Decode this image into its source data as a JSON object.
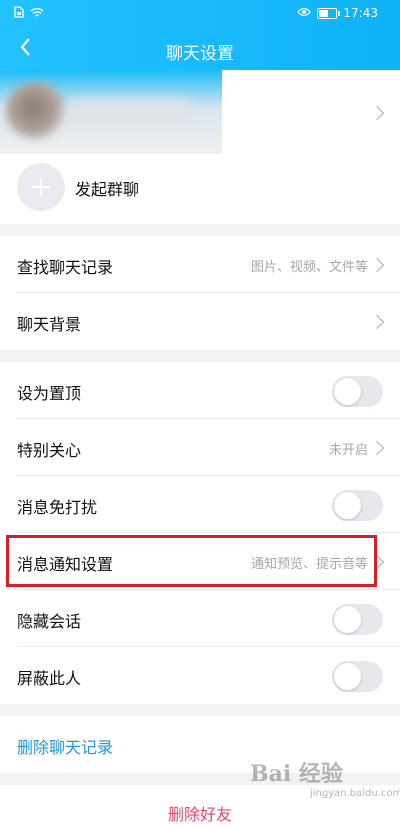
{
  "status_bar": {
    "time": "17:43"
  },
  "header": {
    "title": "聊天设置"
  },
  "group": {
    "start_group_chat": "发起群聊"
  },
  "search_section": [
    {
      "label": "查找聊天记录",
      "hint": "图片、视频、文件等"
    },
    {
      "label": "聊天背景",
      "hint": ""
    }
  ],
  "settings": {
    "pin_top": {
      "label": "设为置顶",
      "on": false
    },
    "special_care": {
      "label": "特别关心",
      "hint": "未开启"
    },
    "dnd": {
      "label": "消息免打扰",
      "on": false
    },
    "notification": {
      "label": "消息通知设置",
      "hint": "通知预览、提示音等"
    },
    "hide_chat": {
      "label": "隐藏会话",
      "on": false
    },
    "block": {
      "label": "屏蔽此人",
      "on": false
    }
  },
  "actions": {
    "delete_history": "删除聊天记录",
    "delete_friend": "删除好友"
  },
  "watermark": {
    "main": "Bai 经验",
    "sub": "jingyan.baidu.com"
  },
  "colors": {
    "header": "#1cbaf9",
    "highlight_box": "#d71f2a",
    "link": "#2196d8",
    "danger": "#e3486b"
  }
}
